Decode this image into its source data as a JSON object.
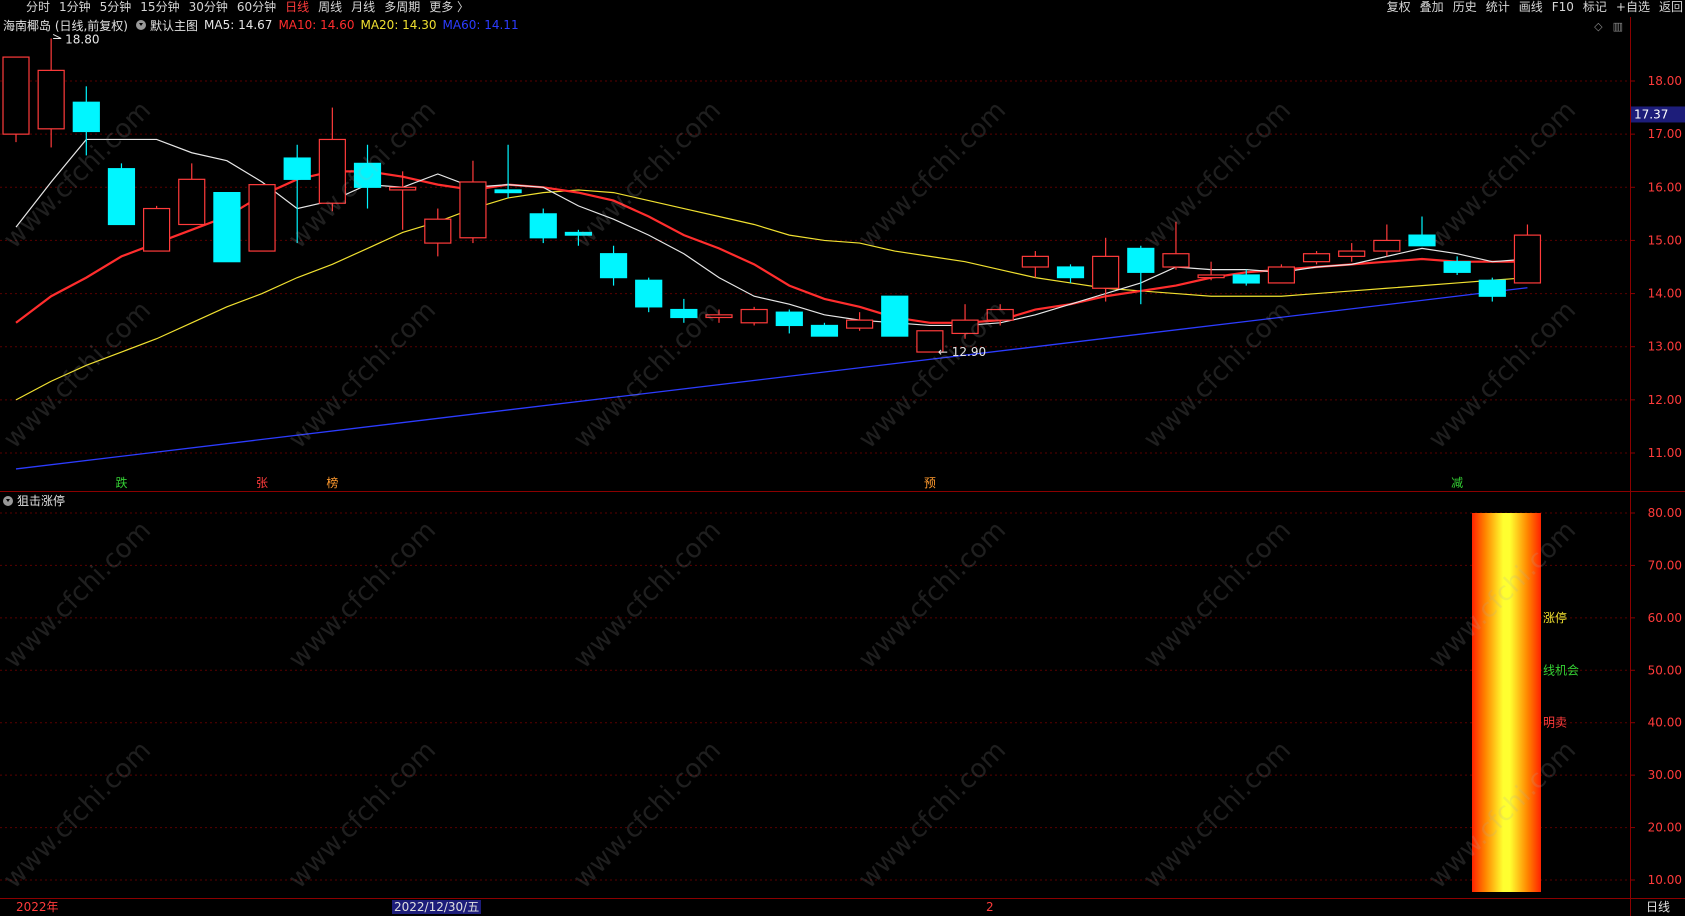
{
  "toolbar": {
    "left": [
      "分时",
      "1分钟",
      "5分钟",
      "15分钟",
      "30分钟",
      "60分钟",
      "日线",
      "周线",
      "月线",
      "多周期",
      "更多 〉"
    ],
    "active": "日线",
    "right": [
      "复权",
      "叠加",
      "历史",
      "统计",
      "画线",
      "F10",
      "标记",
      "+自选",
      "返回"
    ]
  },
  "header": {
    "stock": "海南椰岛 (日线,前复权)",
    "template": "默认主图",
    "ma": [
      {
        "label": "MA5: 14.67",
        "color": "#e6e6e6"
      },
      {
        "label": "MA10: 14.60",
        "color": "#ff2d2d"
      },
      {
        "label": "MA20: 14.30",
        "color": "#f0e030"
      },
      {
        "label": "MA60: 14.11",
        "color": "#2c3cff"
      }
    ]
  },
  "price_axis": [
    "18.00",
    "17.00",
    "16.00",
    "15.00",
    "14.00",
    "13.00",
    "12.00",
    "11.00"
  ],
  "current_price": "17.37",
  "high_marker": "18.80",
  "low_marker": "12.90",
  "signals": [
    {
      "text": "跌",
      "color": "#34d034"
    },
    {
      "text": "张",
      "color": "#ff3b3b"
    },
    {
      "text": "榜",
      "color": "#ff9a2e"
    },
    {
      "text": "预",
      "color": "#ff9a2e"
    },
    {
      "text": "减",
      "color": "#34d034"
    }
  ],
  "indicator": {
    "title": "狙击涨停",
    "axis": [
      "80.00",
      "70.00",
      "60.00",
      "50.00",
      "40.00",
      "30.00",
      "20.00",
      "10.00"
    ],
    "legend": [
      {
        "text": "涨停",
        "color": "#f0e030"
      },
      {
        "text": "线机会",
        "color": "#34d034"
      },
      {
        "text": "明卖",
        "color": "#ff3b3b"
      }
    ]
  },
  "footer": {
    "year": "2022年",
    "date": "2022/12/30/五",
    "marker": "2",
    "period": "日线"
  },
  "watermark": "www.cfchi.com",
  "chart_data": {
    "type": "candlestick",
    "ylim": [
      10.7,
      19.0
    ],
    "candles": [
      {
        "o": 17.0,
        "c": 18.45,
        "h": 18.45,
        "l": 16.85
      },
      {
        "o": 17.1,
        "c": 18.2,
        "h": 18.8,
        "l": 16.75
      },
      {
        "o": 17.6,
        "c": 17.05,
        "h": 17.9,
        "l": 16.6
      },
      {
        "o": 16.35,
        "c": 15.3,
        "h": 16.45,
        "l": 15.3
      },
      {
        "o": 14.8,
        "c": 15.6,
        "h": 15.65,
        "l": 14.8
      },
      {
        "o": 15.3,
        "c": 16.15,
        "h": 16.45,
        "l": 15.3
      },
      {
        "o": 15.9,
        "c": 14.6,
        "h": 15.9,
        "l": 14.6
      },
      {
        "o": 14.8,
        "c": 16.05,
        "h": 16.05,
        "l": 14.8
      },
      {
        "o": 16.55,
        "c": 16.15,
        "h": 16.8,
        "l": 14.95
      },
      {
        "o": 15.7,
        "c": 16.9,
        "h": 17.5,
        "l": 15.55
      },
      {
        "o": 16.45,
        "c": 16.0,
        "h": 16.8,
        "l": 15.6
      },
      {
        "o": 15.95,
        "c": 16.0,
        "h": 16.3,
        "l": 15.2
      },
      {
        "o": 14.95,
        "c": 15.4,
        "h": 15.6,
        "l": 14.7
      },
      {
        "o": 15.05,
        "c": 16.1,
        "h": 16.5,
        "l": 14.95
      },
      {
        "o": 15.95,
        "c": 15.9,
        "h": 16.8,
        "l": 15.8
      },
      {
        "o": 15.5,
        "c": 15.05,
        "h": 15.6,
        "l": 14.95
      },
      {
        "o": 15.15,
        "c": 15.1,
        "h": 15.2,
        "l": 14.9
      },
      {
        "o": 14.75,
        "c": 14.3,
        "h": 14.9,
        "l": 14.15
      },
      {
        "o": 14.25,
        "c": 13.75,
        "h": 14.3,
        "l": 13.65
      },
      {
        "o": 13.7,
        "c": 13.55,
        "h": 13.9,
        "l": 13.45
      },
      {
        "o": 13.55,
        "c": 13.6,
        "h": 13.7,
        "l": 13.45
      },
      {
        "o": 13.45,
        "c": 13.7,
        "h": 13.75,
        "l": 13.4
      },
      {
        "o": 13.65,
        "c": 13.4,
        "h": 13.7,
        "l": 13.25
      },
      {
        "o": 13.4,
        "c": 13.2,
        "h": 13.45,
        "l": 13.2
      },
      {
        "o": 13.35,
        "c": 13.5,
        "h": 13.65,
        "l": 13.3
      },
      {
        "o": 13.95,
        "c": 13.2,
        "h": 13.95,
        "l": 13.2
      },
      {
        "o": 12.9,
        "c": 13.3,
        "h": 13.3,
        "l": 12.9
      },
      {
        "o": 13.25,
        "c": 13.5,
        "h": 13.8,
        "l": 13.15
      },
      {
        "o": 13.5,
        "c": 13.7,
        "h": 13.8,
        "l": 13.4
      },
      {
        "o": 14.5,
        "c": 14.7,
        "h": 14.8,
        "l": 14.3
      },
      {
        "o": 14.5,
        "c": 14.3,
        "h": 14.55,
        "l": 14.2
      },
      {
        "o": 14.1,
        "c": 14.7,
        "h": 15.05,
        "l": 13.85
      },
      {
        "o": 14.85,
        "c": 14.4,
        "h": 14.9,
        "l": 13.8
      },
      {
        "o": 14.5,
        "c": 14.75,
        "h": 15.35,
        "l": 14.45
      },
      {
        "o": 14.3,
        "c": 14.35,
        "h": 14.6,
        "l": 14.25
      },
      {
        "o": 14.35,
        "c": 14.2,
        "h": 14.45,
        "l": 14.15
      },
      {
        "o": 14.2,
        "c": 14.5,
        "h": 14.55,
        "l": 14.2
      },
      {
        "o": 14.6,
        "c": 14.75,
        "h": 14.8,
        "l": 14.55
      },
      {
        "o": 14.7,
        "c": 14.8,
        "h": 14.95,
        "l": 14.6
      },
      {
        "o": 14.8,
        "c": 15.0,
        "h": 15.3,
        "l": 14.7
      },
      {
        "o": 15.1,
        "c": 14.9,
        "h": 15.45,
        "l": 14.9
      },
      {
        "o": 14.6,
        "c": 14.4,
        "h": 14.7,
        "l": 14.35
      },
      {
        "o": 14.25,
        "c": 13.95,
        "h": 14.3,
        "l": 13.85
      },
      {
        "o": 14.2,
        "c": 15.1,
        "h": 15.3,
        "l": 14.2
      }
    ],
    "ma5": [
      15.25,
      16.1,
      16.9,
      16.9,
      16.9,
      16.65,
      16.5,
      16.1,
      15.6,
      15.75,
      16.05,
      16.0,
      16.25,
      16.0,
      16.05,
      16.0,
      15.65,
      15.4,
      15.1,
      14.75,
      14.3,
      13.95,
      13.8,
      13.6,
      13.5,
      13.45,
      13.4,
      13.4,
      13.45,
      13.6,
      13.8,
      14.0,
      14.2,
      14.5,
      14.45,
      14.45,
      14.4,
      14.5,
      14.55,
      14.7,
      14.85,
      14.75,
      14.6,
      14.65
    ],
    "ma10": [
      13.45,
      13.95,
      14.3,
      14.7,
      14.95,
      15.2,
      15.45,
      15.85,
      16.15,
      16.3,
      16.3,
      16.2,
      16.05,
      15.95,
      16.05,
      16.0,
      15.9,
      15.75,
      15.45,
      15.1,
      14.85,
      14.55,
      14.15,
      13.9,
      13.75,
      13.55,
      13.45,
      13.45,
      13.5,
      13.7,
      13.8,
      13.95,
      14.05,
      14.15,
      14.3,
      14.4,
      14.45,
      14.5,
      14.55,
      14.6,
      14.65,
      14.6,
      14.6,
      14.6
    ],
    "ma20": [
      12.0,
      12.35,
      12.65,
      12.9,
      13.15,
      13.45,
      13.75,
      14.0,
      14.3,
      14.55,
      14.85,
      15.15,
      15.35,
      15.6,
      15.8,
      15.9,
      15.95,
      15.9,
      15.75,
      15.6,
      15.45,
      15.3,
      15.1,
      15.0,
      14.95,
      14.8,
      14.7,
      14.6,
      14.45,
      14.3,
      14.2,
      14.1,
      14.05,
      14.0,
      13.95,
      13.95,
      13.95,
      14.0,
      14.05,
      14.1,
      14.15,
      14.2,
      14.25,
      14.3
    ],
    "ma60_start": 10.7,
    "ma60_end": 14.11
  }
}
